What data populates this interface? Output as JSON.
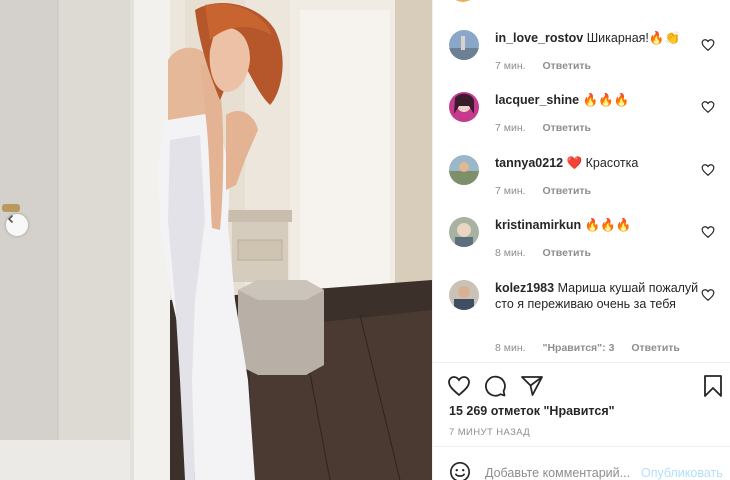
{
  "post": {
    "likes_text": "15 269 отметок \"Нравится\"",
    "time_text": "7 минут назад"
  },
  "comments": [
    {
      "user": "in_love_rostov",
      "text": "Шикарная!🔥👏",
      "time": "7 мин.",
      "likes_label": "",
      "reply": "Ответить"
    },
    {
      "user": "lacquer_shine",
      "text": "🔥🔥🔥",
      "time": "7 мин.",
      "likes_label": "",
      "reply": "Ответить"
    },
    {
      "user": "tannya0212",
      "text": "❤️ Красотка",
      "time": "7 мин.",
      "likes_label": "",
      "reply": "Ответить"
    },
    {
      "user": "kristinamirkun",
      "text": "🔥🔥🔥",
      "time": "8 мин.",
      "likes_label": "",
      "reply": "Ответить"
    },
    {
      "user": "kolez1983",
      "text": "Мариша кушай пожалуй сто я переживаю очень за тебя",
      "time": "8 мин.",
      "likes_label": "\"Нравится\": 3",
      "reply": "Ответить"
    }
  ],
  "composer": {
    "placeholder": "Добавьте комментарий...",
    "publish_label": "Опубликовать"
  },
  "icons": {
    "like": "heart-icon",
    "comment": "comment-bubble-icon",
    "share": "paper-plane-icon",
    "save": "bookmark-icon",
    "emoji": "smiley-icon",
    "prev": "chevron-left-icon"
  },
  "colors": {
    "link_disabled": "#b2dffc",
    "muted": "#8e8e8e",
    "text": "#262626"
  }
}
